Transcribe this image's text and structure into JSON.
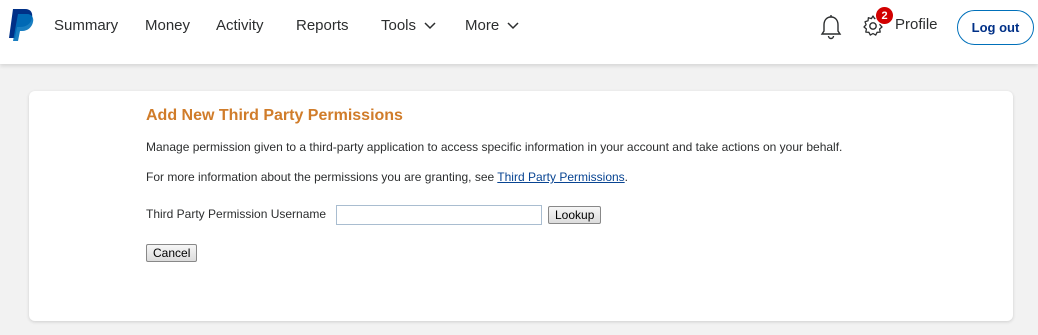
{
  "header": {
    "logo_name": "paypal-logo",
    "nav": [
      {
        "label": "Summary"
      },
      {
        "label": "Money"
      },
      {
        "label": "Activity"
      },
      {
        "label": "Reports"
      },
      {
        "label": "Tools"
      },
      {
        "label": "More"
      }
    ],
    "notification_icon": "bell-icon",
    "settings_icon": "gear-icon",
    "notification_count": "2",
    "profile_label": "Profile",
    "logout_label": "Log out"
  },
  "page": {
    "title": "Add New Third Party Permissions",
    "description": "Manage permission given to a third-party application to access specific information in your account and take actions on your behalf.",
    "info_prefix": "For more information about the permissions you are granting, see ",
    "info_link": "Third Party Permissions",
    "info_suffix": ".",
    "form": {
      "username_label": "Third Party Permission Username",
      "username_value": "",
      "lookup_label": "Lookup",
      "cancel_label": "Cancel"
    }
  },
  "colors": {
    "title": "#d07c2a",
    "link": "#084492",
    "brand_dark": "#003087",
    "brand_light": "#0070ba",
    "badge": "#d20000"
  }
}
